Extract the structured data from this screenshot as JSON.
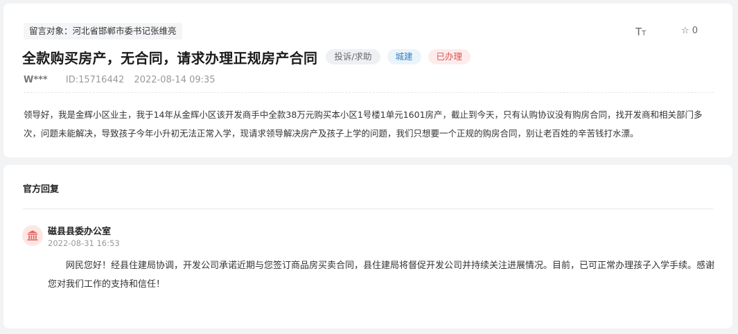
{
  "post": {
    "target": "留言对象：河北省邯郸市委书记张维亮",
    "title": "全款购买房产，无合同，请求办理正规房产合同",
    "tags": {
      "type": "投诉/求助",
      "department": "城建",
      "status": "已办理"
    },
    "author": "W***",
    "id": "ID:15716442",
    "datetime": "2022-08-14 09:35",
    "content": "领导好，我是金辉小区业主，我于14年从金辉小区该开发商手中全款38万元购买本小区1号楼1单元1601房产，截止到今天，只有认购协议没有购房合同，找开发商和相关部门多次，问题未能解决，导致孩子今年小升初无法正常入学，现请求领导解决房产及孩子上学的问题，我们只想要一个正规的购房合同，别让老百姓的辛苦钱打水漂。",
    "font_tool_label": "T",
    "favorite_count": "0"
  },
  "reply": {
    "heading": "官方回复",
    "department": "磁县县委办公室",
    "datetime": "2022-08-31 16:53",
    "content": "网民您好！经县住建局协调，开发公司承诺近期与您签订商品房买卖合同，县住建局将督促开发公司并持续关注进展情况。目前，已可正常办理孩子入学手续。感谢您对我们工作的支持和信任！"
  },
  "icons": {
    "font_size": "font-size-icon",
    "favorite": "star-outline-icon",
    "avatar": "government-building-icon"
  },
  "colors": {
    "status_text": "#d9534f",
    "status_bg": "#fdecec",
    "dept_text": "#3a7fbf",
    "dept_bg": "#eaf4fb",
    "avatar_icon": "#e8625a"
  }
}
